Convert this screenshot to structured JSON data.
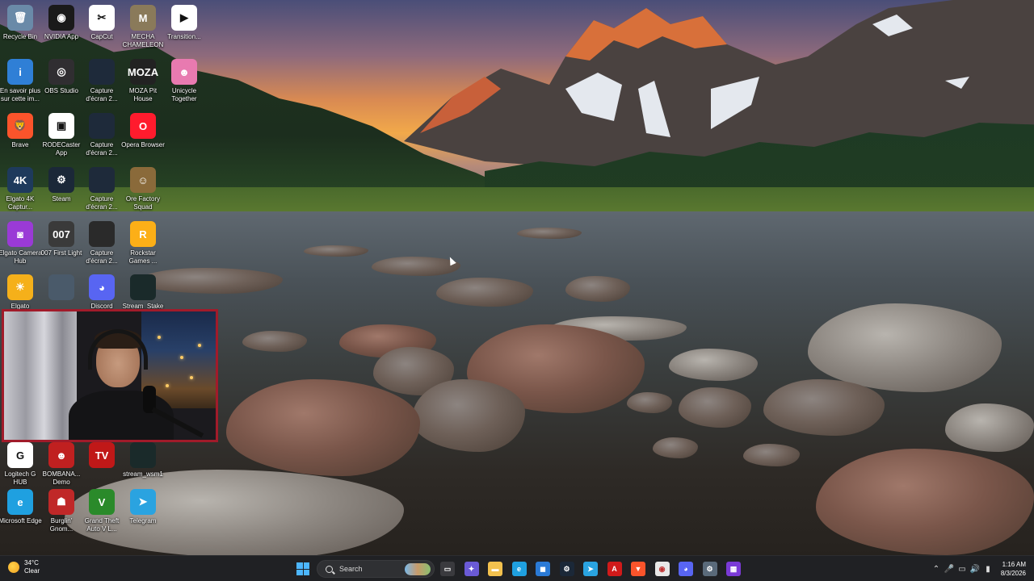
{
  "desktop": {
    "icons": [
      {
        "label": "Recycle Bin",
        "icon": "recycle-bin-icon",
        "color": "#6a8aa8",
        "glyph": "🗑"
      },
      {
        "label": "NVIDIA App",
        "icon": "nvidia-icon",
        "color": "#1a1a1a",
        "glyph": "◉"
      },
      {
        "label": "CapCut",
        "icon": "capcut-icon",
        "color": "#ffffff",
        "glyph": "✂"
      },
      {
        "label": "MECHA CHAMELEON",
        "icon": "mecha-chameleon-icon",
        "color": "#8a7a5a",
        "glyph": "M"
      },
      {
        "label": "Transition...",
        "icon": "transition-icon",
        "color": "#ffffff",
        "glyph": "▶"
      },
      {
        "label": "En savoir plus sur cette im...",
        "icon": "spotlight-icon",
        "color": "#2f7fd6",
        "glyph": "i"
      },
      {
        "label": "OBS Studio",
        "icon": "obs-icon",
        "color": "#302e31",
        "glyph": "◎"
      },
      {
        "label": "Capture d'écran 2...",
        "icon": "screenshot-icon",
        "color": "#1e2a3a",
        "glyph": ""
      },
      {
        "label": "MOZA Pit House",
        "icon": "moza-icon",
        "color": "#222222",
        "glyph": "MOZA"
      },
      {
        "label": "Unicycle Together",
        "icon": "unicycle-icon",
        "color": "#e87ab0",
        "glyph": "☻"
      },
      {
        "label": "Brave",
        "icon": "brave-icon",
        "color": "#fb542b",
        "glyph": "🦁"
      },
      {
        "label": "RODECaster App",
        "icon": "rodecaster-icon",
        "color": "#ffffff",
        "glyph": "▣"
      },
      {
        "label": "Capture d'écran 2...",
        "icon": "screenshot-icon",
        "color": "#1e2a3a",
        "glyph": ""
      },
      {
        "label": "Opera Browser",
        "icon": "opera-icon",
        "color": "#ff1b2d",
        "glyph": "O"
      },
      {
        "label": "Elgato 4K Captur...",
        "icon": "elgato-4k-icon",
        "color": "#1e3a5c",
        "glyph": "4K"
      },
      {
        "label": "Steam",
        "icon": "steam-icon",
        "color": "#1b2838",
        "glyph": "⚙"
      },
      {
        "label": "Capture d'écran 2...",
        "icon": "screenshot-icon",
        "color": "#1e2a3a",
        "glyph": ""
      },
      {
        "label": "Ore Factory Squad",
        "icon": "ore-factory-icon",
        "color": "#8a6a3a",
        "glyph": "☺"
      },
      {
        "label": "Elgato Camera Hub",
        "icon": "elgato-camera-icon",
        "color": "#9a3ad6",
        "glyph": "◙"
      },
      {
        "label": "007 First Light",
        "icon": "007-icon",
        "color": "#3a3a3a",
        "glyph": "007"
      },
      {
        "label": "Capture d'écran 2...",
        "icon": "screenshot-icon",
        "color": "#2a2a2a",
        "glyph": ""
      },
      {
        "label": "Rockstar Games ...",
        "icon": "rockstar-icon",
        "color": "#fcaf17",
        "glyph": "R"
      },
      {
        "label": "Elgato",
        "icon": "elgato-icon",
        "color": "#f5b01a",
        "glyph": "☀"
      },
      {
        "label": "",
        "icon": "game-icon",
        "color": "#4a5a6a",
        "glyph": ""
      },
      {
        "label": "Discord",
        "icon": "discord-icon",
        "color": "#5865f2",
        "glyph": "◕"
      },
      {
        "label": "Stream_Stake",
        "icon": "stream-stake-icon",
        "color": "#1a2a2a",
        "glyph": ""
      },
      {
        "label": "Logitech G HUB",
        "icon": "logitech-icon",
        "color": "#ffffff",
        "glyph": "G"
      },
      {
        "label": "BOMBANA... Demo",
        "icon": "bombana-icon",
        "color": "#c02020",
        "glyph": "☻"
      },
      {
        "label": "",
        "icon": "tv-icon",
        "color": "#c01818",
        "glyph": "TV"
      },
      {
        "label": "stream_wsm1",
        "icon": "stream-wsm1-icon",
        "color": "#1a2a2a",
        "glyph": ""
      },
      {
        "label": "Microsoft Edge",
        "icon": "edge-icon",
        "color": "#1fa0e0",
        "glyph": "e"
      },
      {
        "label": "Burglin' Gnom...",
        "icon": "burglin-gnomes-icon",
        "color": "#c02828",
        "glyph": "☗"
      },
      {
        "label": "Grand Theft Auto V L...",
        "icon": "gta-icon",
        "color": "#2a8a2a",
        "glyph": "V"
      },
      {
        "label": "Telegram",
        "icon": "telegram-icon",
        "color": "#2aa3e0",
        "glyph": "➤"
      }
    ]
  },
  "taskbar": {
    "weather": {
      "temp": "34°C",
      "condition": "Clear"
    },
    "search_placeholder": "Search",
    "apps": [
      {
        "icon": "task-view-icon",
        "color": "#3a3a3e",
        "glyph": "▭"
      },
      {
        "icon": "copilot-icon",
        "color": "#6a5ad6",
        "glyph": "✦"
      },
      {
        "icon": "file-explorer-icon",
        "color": "#f2c14e",
        "glyph": "▬"
      },
      {
        "icon": "edge-icon",
        "color": "#1fa0e0",
        "glyph": "e"
      },
      {
        "icon": "store-icon",
        "color": "#2a7ad6",
        "glyph": "◼"
      },
      {
        "icon": "steam-icon",
        "color": "#1b2838",
        "glyph": "⚙"
      },
      {
        "icon": "telegram-icon",
        "color": "#2aa3e0",
        "glyph": "➤"
      },
      {
        "icon": "adobe-icon",
        "color": "#d01a1a",
        "glyph": "A"
      },
      {
        "icon": "brave-icon",
        "color": "#fb542b",
        "glyph": "▼"
      },
      {
        "icon": "chrome-icon",
        "color": "#e8e8e8",
        "glyph": "◉"
      },
      {
        "icon": "discord-icon",
        "color": "#5865f2",
        "glyph": "◕"
      },
      {
        "icon": "settings-icon",
        "color": "#5a6a7a",
        "glyph": "⚙"
      },
      {
        "icon": "app-grid-icon",
        "color": "#7a3ad6",
        "glyph": "▦"
      }
    ],
    "tray": [
      {
        "icon": "chevron-up-icon",
        "glyph": "⌃"
      },
      {
        "icon": "microphone-icon",
        "glyph": "🎤"
      },
      {
        "icon": "network-icon",
        "glyph": "▭"
      },
      {
        "icon": "volume-icon",
        "glyph": "🔊"
      },
      {
        "icon": "battery-icon",
        "glyph": "▮"
      }
    ],
    "clock": {
      "time": "1:16 AM",
      "date": "8/3/2026"
    }
  }
}
